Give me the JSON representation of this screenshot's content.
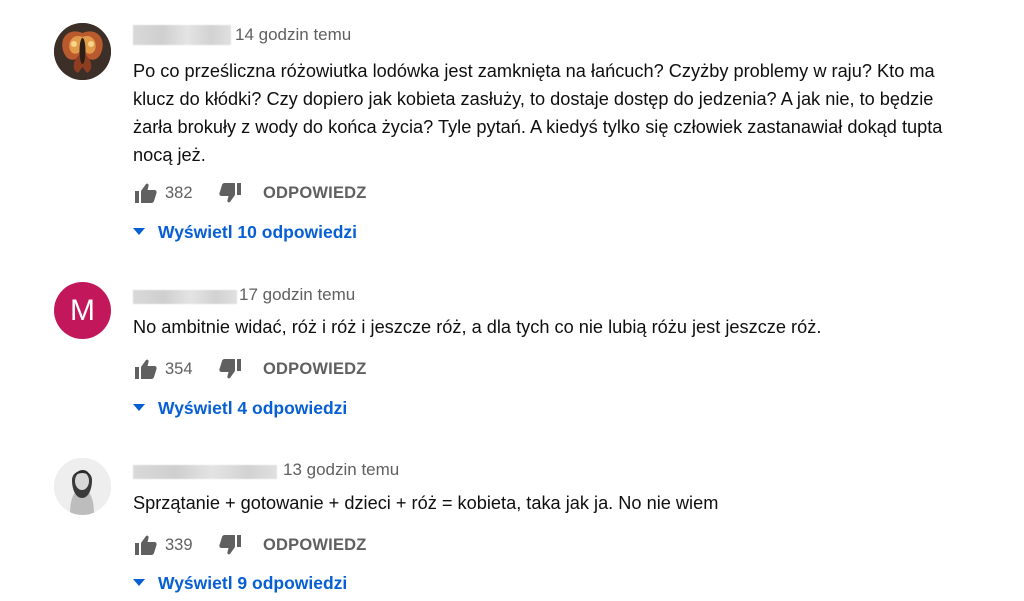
{
  "comments": [
    {
      "time": "14 godzin temu",
      "text": "Po co prześliczna różowiutka lodówka jest zamknięta na łańcuch? Czyżby problemy w raju? Kto ma klucz do kłódki? Czy dopiero jak kobieta zasłuży, to dostaje dostęp do jedzenia? A jak nie, to będzie żarła brokuły z wody do końca życia? Tyle pytań. A kiedyś tylko się człowiek zastanawiał dokąd tupta nocą jeż.",
      "likes": "382",
      "reply_label": "ODPOWIEDZ",
      "view_replies": "Wyświetl 10 odpowiedzi",
      "avatar": "moth-image-avatar"
    },
    {
      "time": "17 godzin temu",
      "avatar_letter": "M",
      "avatar_color": "#c2185b",
      "text": "No ambitnie widać, róż i róż i jeszcze róż, a dla tych co nie lubią różu jest jeszcze róż.",
      "likes": "354",
      "reply_label": "ODPOWIEDZ",
      "view_replies": "Wyświetl 4 odpowiedzi"
    },
    {
      "time": "13 godzin temu",
      "text": "Sprzątanie +  gotowanie + dzieci + róż = kobieta, taka jak ja. No nie wiem",
      "likes": "339",
      "reply_label": "ODPOWIEDZ",
      "view_replies": "Wyświetl 9 odpowiedzi",
      "avatar": "woman-photo-avatar"
    }
  ],
  "colors": {
    "link": "#065fd4",
    "secondary_text": "#606060",
    "primary_text": "#0f0f0f"
  },
  "icons": [
    "thumb-up-icon",
    "thumb-down-icon",
    "caret-down-icon"
  ]
}
